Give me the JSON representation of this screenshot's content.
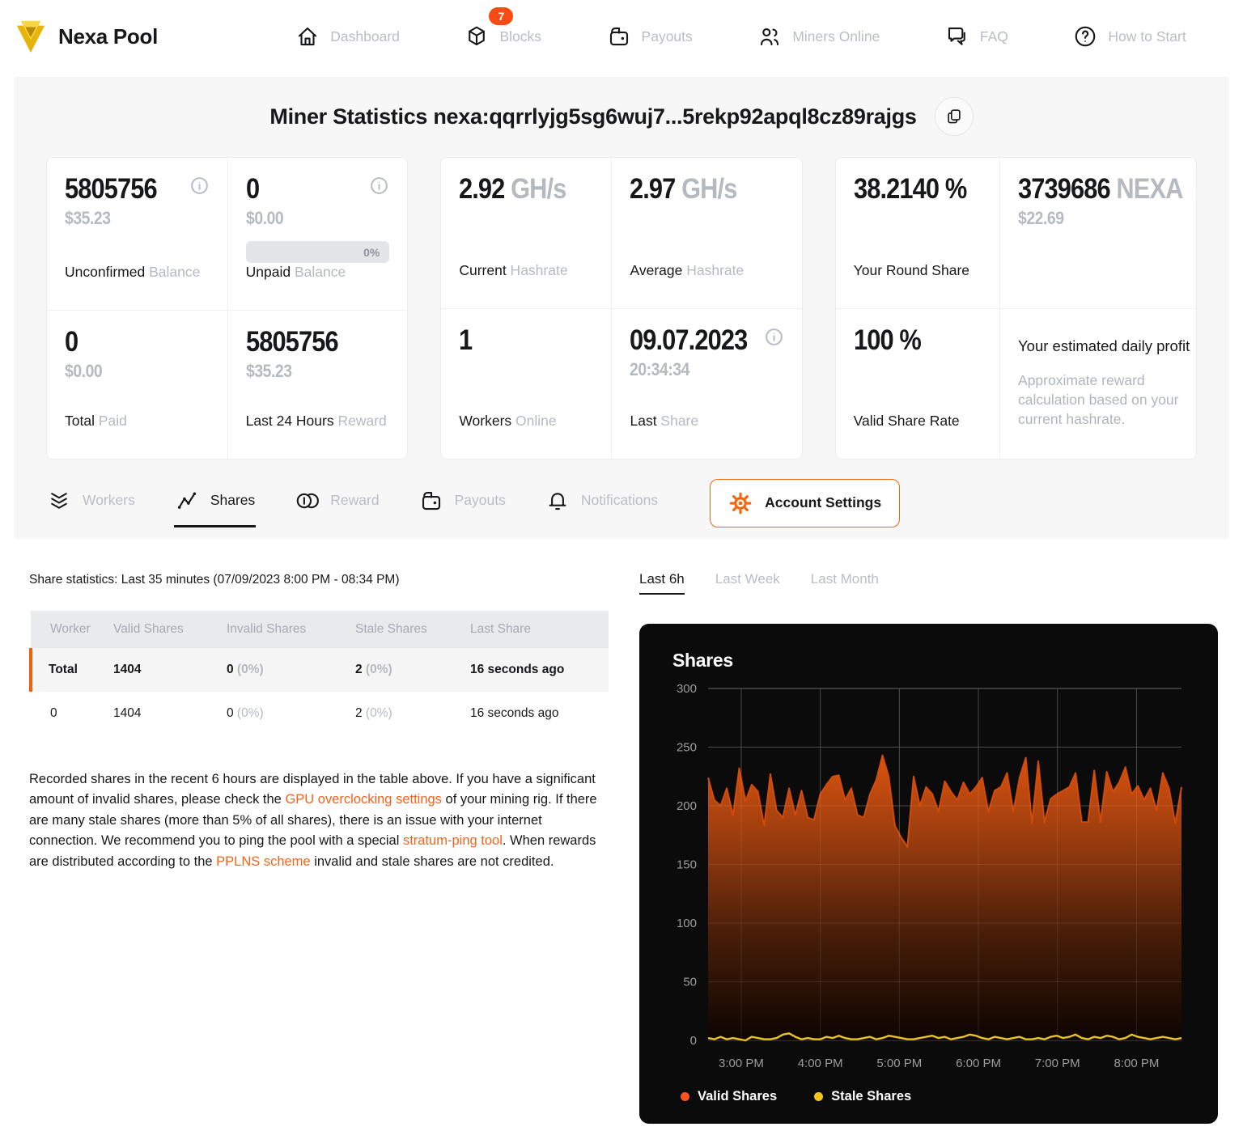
{
  "nav": {
    "brand": "Nexa Pool",
    "items": [
      {
        "label": "Dashboard"
      },
      {
        "label": "Blocks",
        "badge": "7"
      },
      {
        "label": "Payouts"
      },
      {
        "label": "Miners Online"
      },
      {
        "label": "FAQ"
      },
      {
        "label": "How to Start"
      }
    ]
  },
  "header": {
    "title": "Miner Statistics nexa:qqrrlyjg5sg6wuj7...5rekp92apql8cz89rajgs"
  },
  "stats": {
    "unconfirmed": {
      "value": "5805756",
      "usd": "$35.23",
      "label_main": "Unconfirmed",
      "label_sub": " Balance"
    },
    "unpaid": {
      "value": "0",
      "usd": "$0.00",
      "progress": "0%",
      "label_main": "Unpaid",
      "label_sub": " Balance"
    },
    "total_paid": {
      "value": "0",
      "usd": "$0.00",
      "label_main": "Total",
      "label_sub": " Paid"
    },
    "last24h": {
      "value": "5805756",
      "usd": "$35.23",
      "label_main": "Last 24 Hours",
      "label_sub": " Reward"
    },
    "current_hashrate": {
      "value": "2.92",
      "unit": " GH/s",
      "label_main": "Current",
      "label_sub": " Hashrate"
    },
    "average_hashrate": {
      "value": "2.97",
      "unit": " GH/s",
      "label_main": "Average",
      "label_sub": " Hashrate"
    },
    "workers_online": {
      "value": "1",
      "label_main": "Workers",
      "label_sub": " Online"
    },
    "last_share": {
      "value": "09.07.2023",
      "time": "20:34:34",
      "label_main": "Last",
      "label_sub": " Share"
    },
    "round_share": {
      "value": "38.2140 %",
      "label_main": "Your Round Share"
    },
    "daily_nexa": {
      "value": "3739686",
      "unit": " NEXA",
      "usd": "$22.69"
    },
    "valid_share_rate": {
      "value": "100 %",
      "label_main": "Valid Share Rate"
    },
    "profit_note": {
      "title": "Your estimated daily profit",
      "text": "Approximate reward calculation based on your current hashrate."
    }
  },
  "tabs": {
    "items": [
      {
        "label": "Workers"
      },
      {
        "label": "Shares"
      },
      {
        "label": "Reward"
      },
      {
        "label": "Payouts"
      },
      {
        "label": "Notifications"
      }
    ],
    "account_settings": "Account Settings"
  },
  "share_section": {
    "heading": "Share statistics: Last 35 minutes (07/09/2023 8:00 PM - 08:34 PM)",
    "table": {
      "headers": [
        "Worker",
        "Valid Shares",
        "Invalid Shares",
        "Stale Shares",
        "Last Share"
      ],
      "rows": [
        {
          "cells": [
            {
              "main": "Total"
            },
            {
              "main": "1404"
            },
            {
              "main": "0",
              "sub": " (0%)"
            },
            {
              "main": "2",
              "sub": " (0%)"
            },
            {
              "main": "16 seconds ago"
            }
          ]
        },
        {
          "cells": [
            {
              "main": "0"
            },
            {
              "main": "1404"
            },
            {
              "main": "0",
              "sub": " (0%)"
            },
            {
              "main": "2",
              "sub": " (0%)"
            },
            {
              "main": "16 seconds ago"
            }
          ]
        }
      ]
    },
    "paragraph": [
      {
        "text": "Recorded shares in the recent 6 hours are displayed in the table above. If you have a significant amount of invalid shares, please check the "
      },
      {
        "text": "GPU overclocking settings",
        "link": true
      },
      {
        "text": " of your mining rig. If there are many stale shares (more than 5% of all shares), there is an issue with your internet connection. We recommend you to ping the pool with a special "
      },
      {
        "text": "stratum-ping tool",
        "link": true
      },
      {
        "text": ". When rewards are distributed according to the "
      },
      {
        "text": "PPLNS scheme",
        "link": true
      },
      {
        "text": " invalid and stale shares are not credited."
      }
    ]
  },
  "chart": {
    "range_tabs": [
      "Last 6h",
      "Last Week",
      "Last Month"
    ],
    "active_range": "Last 6h"
  },
  "chart_data": {
    "type": "area",
    "title": "Shares",
    "ylim": [
      0,
      300
    ],
    "yticks": [
      0,
      50,
      100,
      150,
      200,
      250,
      300
    ],
    "grid": true,
    "legend_position": "bottom-left",
    "x_axis": {
      "start": "2:35 PM",
      "end": "8:34 PM",
      "tick_labels": [
        "3:00 PM",
        "4:00 PM",
        "5:00 PM",
        "6:00 PM",
        "7:00 PM",
        "8:00 PM"
      ],
      "tick_fractions": [
        0.07,
        0.237,
        0.404,
        0.571,
        0.738,
        0.905
      ]
    },
    "colors": {
      "grid": "#383838",
      "grid_top": "#5a5a5a",
      "tick_text": "#9c9c9c",
      "background": "#0b0b0b"
    },
    "series": [
      {
        "name": "Valid Shares",
        "type": "area",
        "line_color": "#d14b0c",
        "legend_color": "#fa541c",
        "fill_gradient": [
          [
            "0%",
            "#f2690f"
          ],
          [
            "20%",
            "#d85210"
          ],
          [
            "45%",
            "#933a0e"
          ],
          [
            "70%",
            "#481d08"
          ],
          [
            "100%",
            "#0d0502"
          ]
        ],
        "values": [
          224,
          205,
          200,
          215,
          192,
          232,
          204,
          218,
          212,
          183,
          227,
          196,
          190,
          215,
          192,
          213,
          190,
          188,
          210,
          218,
          225,
          226,
          205,
          215,
          192,
          190,
          210,
          222,
          243,
          225,
          183,
          173,
          165,
          225,
          200,
          216,
          210,
          195,
          221,
          212,
          205,
          220,
          210,
          216,
          224,
          195,
          213,
          216,
          228,
          195,
          224,
          241,
          185,
          238,
          186,
          206,
          210,
          213,
          216,
          228,
          186,
          186,
          230,
          186,
          229,
          212,
          220,
          233,
          210,
          217,
          205,
          215,
          196,
          228,
          215,
          185,
          216
        ]
      },
      {
        "name": "Stale Shares",
        "type": "line",
        "line_color": "#e9c427",
        "legend_color": "#f5c51c",
        "values": [
          2,
          1,
          3,
          1,
          2,
          1,
          0,
          3,
          2,
          1,
          1,
          2,
          5,
          6,
          3,
          1,
          2,
          1,
          1,
          3,
          2,
          4,
          2,
          1,
          1,
          2,
          3,
          1,
          2,
          4,
          3,
          2,
          1,
          1,
          2,
          3,
          4,
          2,
          3,
          1,
          2,
          3,
          5,
          4,
          2,
          1,
          3,
          2,
          1,
          2,
          3,
          1,
          1,
          2,
          1,
          3,
          4,
          2,
          3,
          5,
          2,
          1,
          3,
          2,
          4,
          3,
          1,
          2,
          5,
          3,
          2,
          1,
          2,
          3,
          2,
          1,
          2
        ]
      }
    ]
  }
}
